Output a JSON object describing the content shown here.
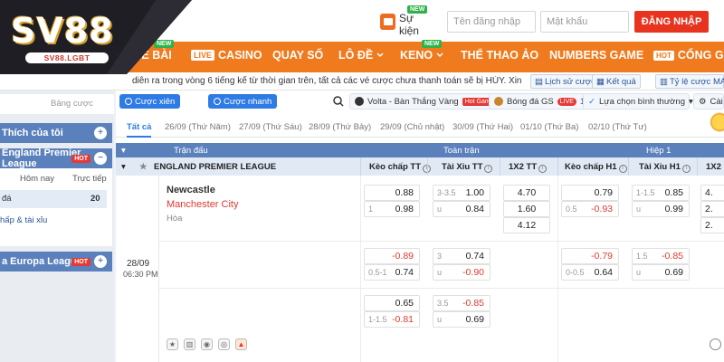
{
  "brand": {
    "logo": "SV88",
    "domain": "SV88.LGBT"
  },
  "header": {
    "event_label": "Sự kiện",
    "event_new": "NEW",
    "username_placeholder": "Tên đăng nhập",
    "password_placeholder": "Mật khẩu",
    "login_label": "ĐĂNG NHẬP"
  },
  "nav": {
    "items": [
      "ME BÀI",
      "CASINO",
      "QUAY SỐ",
      "LÔ ĐỀ",
      "KENO",
      "THỂ THAO ẢO",
      "NUMBERS GAME",
      "CỔNG GAME"
    ],
    "live_tag": "LIVE",
    "hot_tag": "HOT",
    "new_tag": "NEW"
  },
  "notice": {
    "text": "diễn ra trong vòng 6 tiếng kể từ thời gian trên, tất cả các vé cược chưa thanh toán sẽ bị HỦY. Xin cảm ơn!",
    "history_label": "Lịch sử cược",
    "results_label": "Kết quả",
    "ratio_label": "Tỷ lệ cược MA"
  },
  "sidebar": {
    "tab_label": "Bảng cược",
    "favorites_label": "Thích của tôi",
    "league1_label": "England Premier League",
    "hot_tag": "HOT",
    "col_today": "Hôm nay",
    "col_live": "Trực tiếp",
    "row_label": "đá",
    "row_count": "20",
    "link_label": "hấp & tài xỉu",
    "league2_label": "a Europa League",
    "plus": "+"
  },
  "main": {
    "bet_mix": "Cược xiên",
    "bet_fast": "Cược nhanh",
    "live1_teams": "Volta - Bàn Thắng Vàng",
    "live1_tag": "Hot Game",
    "live2_label": "Bóng đá GS",
    "live2_tag": "LIVE",
    "live2_count": "10",
    "sort_label": "Lựa chọn bình thường",
    "settings_label": "Cài đ",
    "date_tabs": [
      "Tất cả",
      "26/09 (Thứ Năm)",
      "27/09 (Thứ Sáu)",
      "28/09 (Thứ Bảy)",
      "29/09 (Chủ nhật)",
      "30/09 (Thứ Hai)",
      "01/10 (Thứ Ba)",
      "02/10 (Thứ Tư)"
    ],
    "head_match": "Trận đấu",
    "head_full": "Toàn trận",
    "head_half": "Hiệp 1",
    "league_name": "ENGLAND PREMIER LEAGUE",
    "cols": [
      "Kèo chấp TT",
      "Tài Xỉu TT",
      "1X2 TT",
      "Kèo chấp H1",
      "Tài Xỉu H1",
      "1X2"
    ]
  },
  "match": {
    "date": "28/09",
    "time": "06:30 PM",
    "home": "Newcastle",
    "away": "Manchester City",
    "draw": "Hòa",
    "row1": {
      "hc_h1": "",
      "hc_v1": "0.88",
      "hc_h2": "1",
      "hc_v2": "0.98",
      "ou_h1": "3-3.5",
      "ou_v1": "1.00",
      "ou_h2": "u",
      "ou_v2": "0.84",
      "x1": "4.70",
      "x2": "1.60",
      "x3": "4.12",
      "h1hc_h1": "",
      "h1hc_v1": "0.79",
      "h1hc_h2": "0.5",
      "h1hc_v2": "-0.93",
      "h1ou_h1": "1-1.5",
      "h1ou_v1": "0.85",
      "h1ou_h2": "u",
      "h1ou_v2": "0.99",
      "h1x1": "4.",
      "h1x2": "2.",
      "h1x3": "2."
    },
    "row2": {
      "hc_h1": "",
      "hc_v1": "-0.89",
      "hc_h2": "0.5-1",
      "hc_v2": "0.74",
      "ou_h1": "3",
      "ou_v1": "0.74",
      "ou_h2": "u",
      "ou_v2": "-0.90",
      "h1hc_h1": "",
      "h1hc_v1": "-0.79",
      "h1hc_h2": "0-0.5",
      "h1hc_v2": "0.64",
      "h1ou_h1": "1.5",
      "h1ou_v1": "-0.85",
      "h1ou_h2": "u",
      "h1ou_v2": "0.69"
    },
    "row3": {
      "hc_h1": "",
      "hc_v1": "0.65",
      "hc_h2": "1-1.5",
      "hc_v2": "-0.81",
      "ou_h1": "3.5",
      "ou_v1": "-0.85",
      "ou_h2": "u",
      "ou_v2": "0.69"
    }
  },
  "colors": {
    "brand_orange": "#f07a1e",
    "login_red": "#e8331f",
    "table_blue": "#5b81bd",
    "negative_red": "#e03a2f"
  }
}
